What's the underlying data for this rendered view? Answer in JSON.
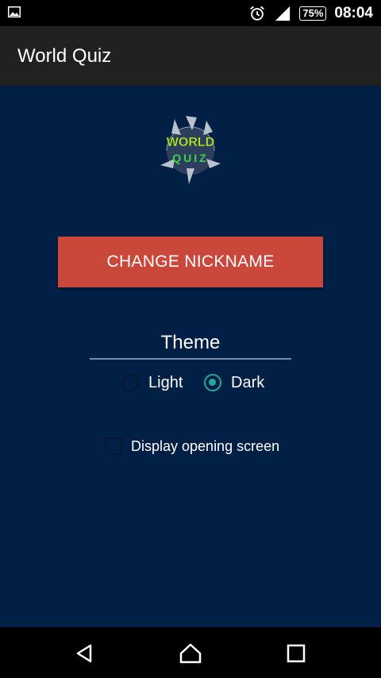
{
  "status_bar": {
    "battery": "75%",
    "time": "08:04",
    "icons": [
      "gallery-icon",
      "alarm-icon",
      "signal-icon",
      "battery-icon"
    ]
  },
  "app_bar": {
    "title": "World Quiz"
  },
  "logo": {
    "line1": "WORLD",
    "line2": "QUIZ"
  },
  "main": {
    "change_nickname_label": "CHANGE NICKNAME",
    "theme": {
      "title": "Theme",
      "options": [
        {
          "label": "Light",
          "selected": false
        },
        {
          "label": "Dark",
          "selected": true
        }
      ]
    },
    "opening_screen": {
      "label": "Display opening screen",
      "checked": false
    }
  },
  "colors": {
    "background": "#021f45",
    "app_bar": "#212121",
    "button": "#c9473b",
    "accent": "#26a69a"
  },
  "nav_bar": {
    "icons": [
      "back-icon",
      "home-icon",
      "recents-icon"
    ]
  }
}
